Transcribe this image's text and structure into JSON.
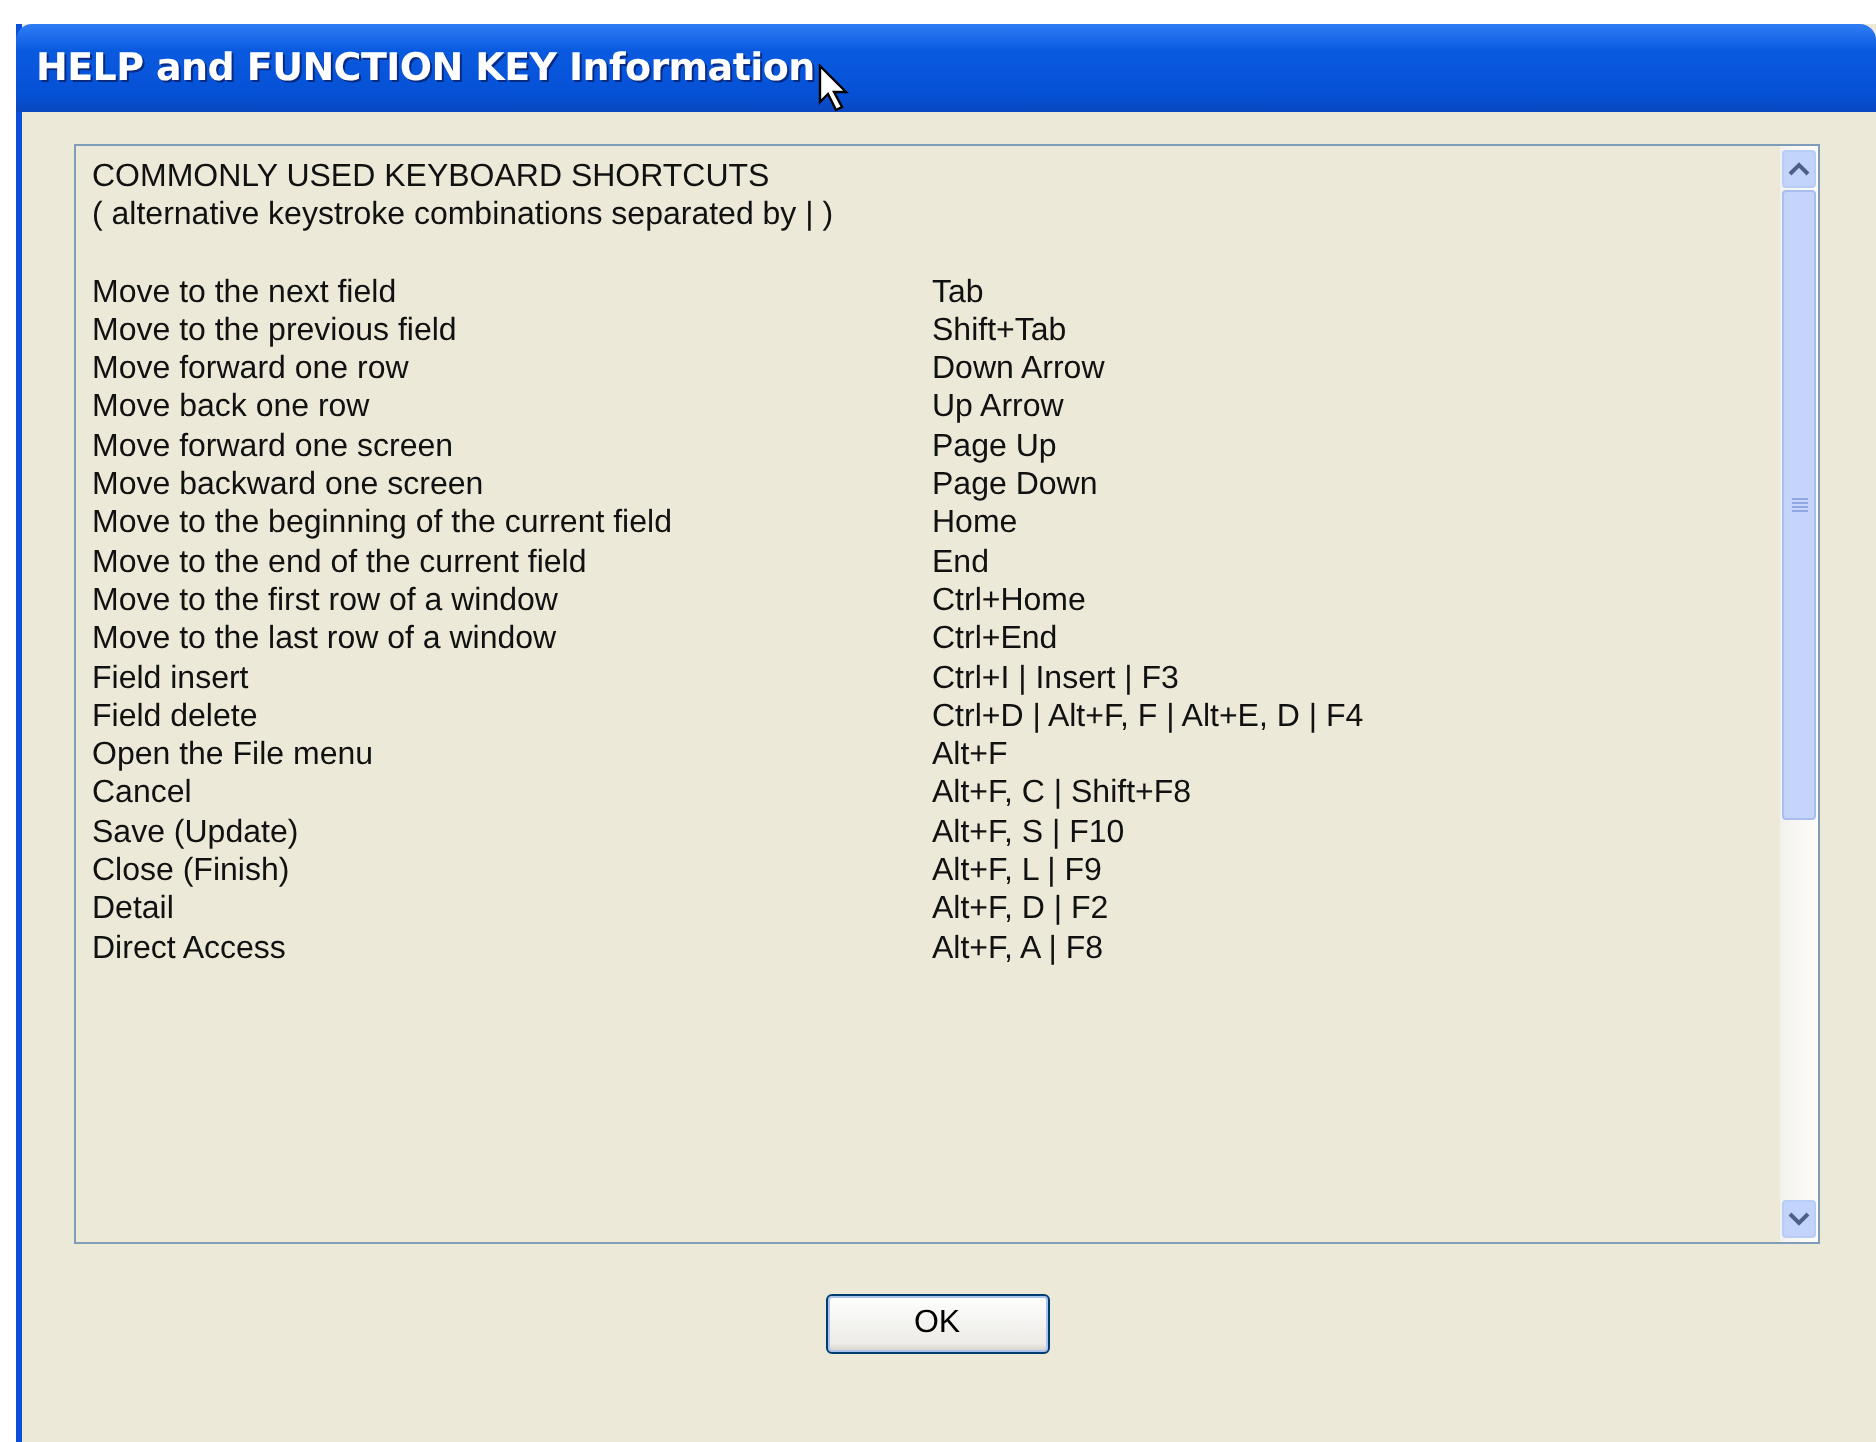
{
  "window": {
    "title": "HELP and FUNCTION KEY Information"
  },
  "help": {
    "heading": "COMMONLY USED KEYBOARD SHORTCUTS",
    "note": "( alternative keystroke combinations separated by | )",
    "rows": [
      {
        "action": "Move to the next field",
        "keys": "Tab"
      },
      {
        "action": "Move to the previous field",
        "keys": "Shift+Tab"
      },
      {
        "action": "Move forward one row",
        "keys": "Down Arrow"
      },
      {
        "action": "Move back one row",
        "keys": "Up Arrow"
      },
      {
        "action": "Move forward one screen",
        "keys": "Page Up"
      },
      {
        "action": "Move backward one screen",
        "keys": "Page Down"
      },
      {
        "action": "Move to the beginning of the current field",
        "keys": "Home"
      },
      {
        "action": "Move to the end of the current field",
        "keys": "End"
      },
      {
        "action": "Move to the first row of a window",
        "keys": "Ctrl+Home"
      },
      {
        "action": "Move to the last row of a window",
        "keys": "Ctrl+End"
      },
      {
        "action": "Field insert",
        "keys": "Ctrl+I | Insert | F3"
      },
      {
        "action": "Field delete",
        "keys": "Ctrl+D | Alt+F, F | Alt+E, D | F4"
      },
      {
        "action": "Open the File menu",
        "keys": "Alt+F"
      },
      {
        "action": "Cancel",
        "keys": "Alt+F, C | Shift+F8"
      },
      {
        "action": "Save (Update)",
        "keys": "Alt+F, S | F10"
      },
      {
        "action": "Close (Finish)",
        "keys": "Alt+F, L | F9"
      },
      {
        "action": "Detail",
        "keys": "Alt+F, D | F2"
      },
      {
        "action": "Direct Access",
        "keys": "Alt+F, A | F8"
      }
    ]
  },
  "buttons": [
    {
      "label": "OK"
    }
  ]
}
